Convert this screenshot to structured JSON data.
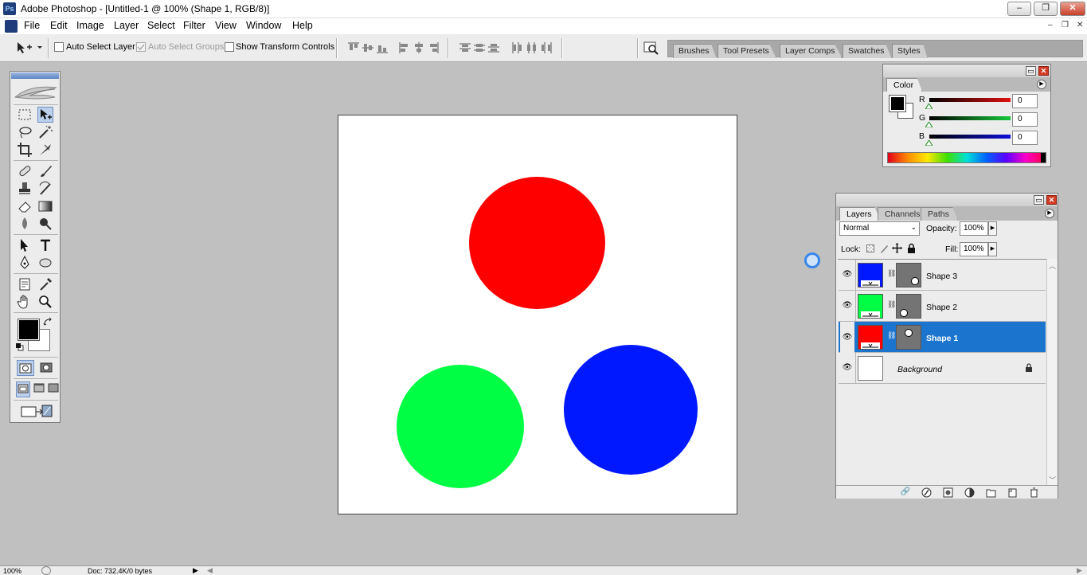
{
  "window": {
    "title": "Adobe Photoshop - [Untitled-1 @ 100% (Shape 1, RGB/8)]",
    "minimize": "‒",
    "restore": "❐",
    "close": "✕"
  },
  "menu": {
    "items": [
      "File",
      "Edit",
      "Image",
      "Layer",
      "Select",
      "Filter",
      "View",
      "Window",
      "Help"
    ],
    "doc_controls": [
      "–",
      "❐",
      "✕"
    ]
  },
  "options": {
    "auto_select_layer": "Auto Select Layer",
    "auto_select_groups": "Auto Select Groups",
    "show_transform_controls": "Show Transform Controls"
  },
  "palette_well": {
    "tabs": [
      "Brushes",
      "Tool Presets",
      "Layer Comps",
      "Swatches",
      "Styles"
    ]
  },
  "canvas": {
    "background": "#ffffff",
    "shapes": [
      {
        "name": "red-circle",
        "color": "#ff0000"
      },
      {
        "name": "green-circle",
        "color": "#00ff44"
      },
      {
        "name": "blue-circle",
        "color": "#0018ff"
      }
    ]
  },
  "color_panel": {
    "tab": "Color",
    "channels": [
      {
        "label": "R",
        "value": "0",
        "color": "#e01010"
      },
      {
        "label": "G",
        "value": "0",
        "color": "#16c83a"
      },
      {
        "label": "B",
        "value": "0",
        "color": "#1010d8"
      }
    ]
  },
  "layers_panel": {
    "tabs": [
      "Layers",
      "Channels",
      "Paths"
    ],
    "blend_mode": "Normal",
    "opacity_label": "Opacity:",
    "opacity_value": "100%",
    "lock_label": "Lock:",
    "fill_label": "Fill:",
    "fill_value": "100%",
    "layers": [
      {
        "name": "Shape 3",
        "color": "#0018ff",
        "selected": false
      },
      {
        "name": "Shape 2",
        "color": "#00ff44",
        "selected": false
      },
      {
        "name": "Shape 1",
        "color": "#ff0000",
        "selected": true
      },
      {
        "name": "Background",
        "color": "#ffffff",
        "selected": false
      }
    ]
  },
  "statusbar": {
    "zoom": "100%",
    "doc_info": "Doc: 732.4K/0 bytes"
  }
}
